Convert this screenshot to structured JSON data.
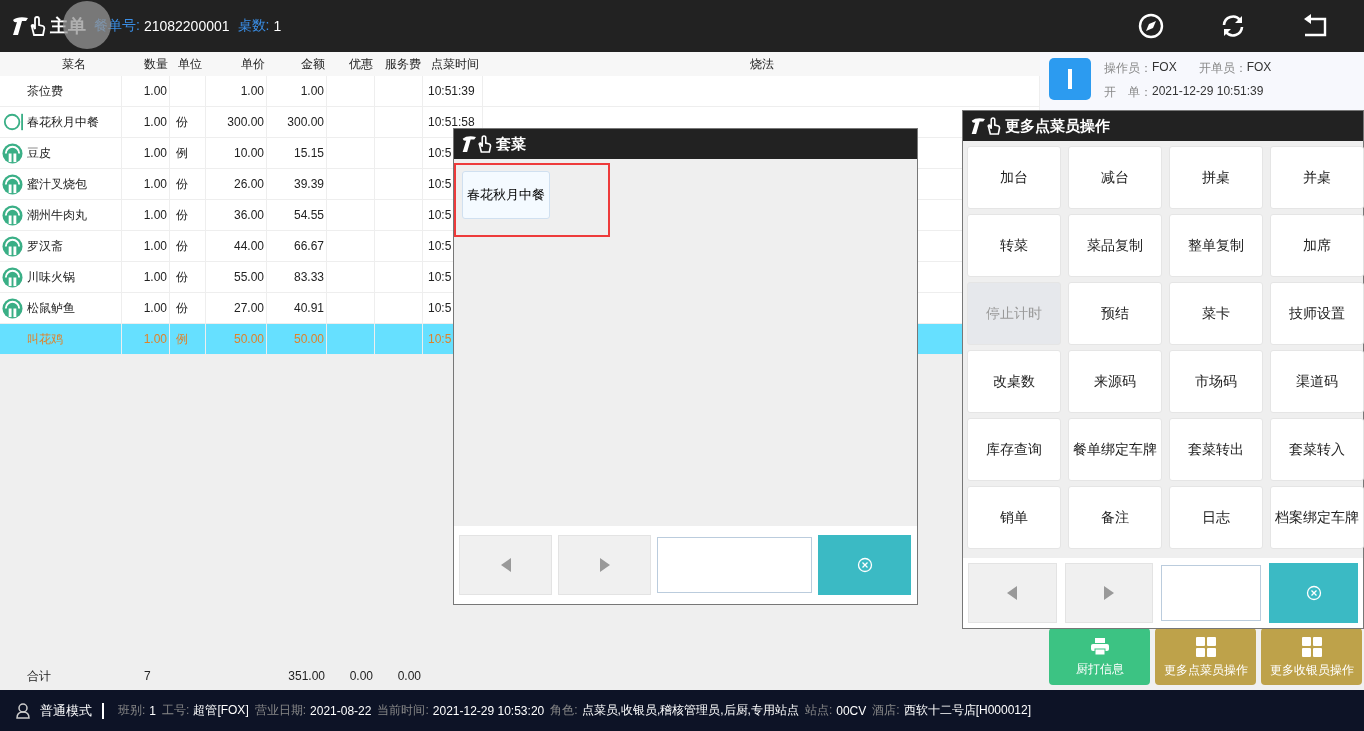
{
  "header": {
    "title": "主单",
    "order_label": "餐单号:",
    "order_no": "21082200001",
    "tables_label": "桌数:",
    "tables": "1"
  },
  "table": {
    "columns": [
      "菜名",
      "数量",
      "单位",
      "单价",
      "金额",
      "优惠",
      "服务费",
      "点菜时间",
      "烧法"
    ],
    "rows": [
      {
        "kind": "none",
        "name": "茶位费",
        "qty": "1.00",
        "unit": "",
        "price": "1.00",
        "amount": "1.00",
        "time": "10:51:39",
        "selected": false
      },
      {
        "kind": "ring",
        "name": "春花秋月中餐",
        "qty": "1.00",
        "unit": "份",
        "price": "300.00",
        "amount": "300.00",
        "time": "10:51:58",
        "selected": false
      },
      {
        "kind": "dish",
        "name": "豆皮",
        "qty": "1.00",
        "unit": "例",
        "price": "10.00",
        "amount": "15.15",
        "time": "10:5",
        "selected": false
      },
      {
        "kind": "dish",
        "name": "蜜汁叉烧包",
        "qty": "1.00",
        "unit": "份",
        "price": "26.00",
        "amount": "39.39",
        "time": "10:5",
        "selected": false
      },
      {
        "kind": "dish",
        "name": "潮州牛肉丸",
        "qty": "1.00",
        "unit": "份",
        "price": "36.00",
        "amount": "54.55",
        "time": "10:5",
        "selected": false
      },
      {
        "kind": "dish",
        "name": "罗汉斋",
        "qty": "1.00",
        "unit": "份",
        "price": "44.00",
        "amount": "66.67",
        "time": "10:5",
        "selected": false
      },
      {
        "kind": "dish",
        "name": "川味火锅",
        "qty": "1.00",
        "unit": "份",
        "price": "55.00",
        "amount": "83.33",
        "time": "10:5",
        "selected": false
      },
      {
        "kind": "dish",
        "name": "松鼠鲈鱼",
        "qty": "1.00",
        "unit": "份",
        "price": "27.00",
        "amount": "40.91",
        "time": "10:5",
        "selected": false
      },
      {
        "kind": "none",
        "name": "叫花鸡",
        "qty": "1.00",
        "unit": "例",
        "price": "50.00",
        "amount": "50.00",
        "time": "10:5",
        "selected": true
      }
    ],
    "totals": {
      "label": "合计",
      "qty": "7",
      "amount": "351.00",
      "discount": "0.00",
      "service": "0.00"
    }
  },
  "info": {
    "operator_label": "操作员：",
    "operator": "FOX",
    "opener_label": "开单员：",
    "opener": "FOX",
    "open_label": "开　单：",
    "open_time": "2021-12-29 10:51:39"
  },
  "action_buttons": [
    {
      "kind": "print",
      "label": "厨打信息"
    },
    {
      "kind": "grid",
      "label": "更多点菜员操作"
    },
    {
      "kind": "grid",
      "label": "更多收银员操作"
    }
  ],
  "set_dialog": {
    "title": "套菜",
    "items": [
      {
        "label": "春花秋月中餐",
        "highlighted": true
      }
    ]
  },
  "ops_dialog": {
    "title": "更多点菜员操作",
    "buttons": [
      {
        "label": "加台",
        "disabled": false
      },
      {
        "label": "减台",
        "disabled": false
      },
      {
        "label": "拼桌",
        "disabled": false
      },
      {
        "label": "并桌",
        "disabled": false
      },
      {
        "label": "转菜",
        "disabled": false
      },
      {
        "label": "菜品复制",
        "disabled": false
      },
      {
        "label": "整单复制",
        "disabled": false
      },
      {
        "label": "加席",
        "disabled": false
      },
      {
        "label": "停止计时",
        "disabled": true
      },
      {
        "label": "预结",
        "disabled": false
      },
      {
        "label": "菜卡",
        "disabled": false
      },
      {
        "label": "技师设置",
        "disabled": false
      },
      {
        "label": "改桌数",
        "disabled": false
      },
      {
        "label": "来源码",
        "disabled": false
      },
      {
        "label": "市场码",
        "disabled": false
      },
      {
        "label": "渠道码",
        "disabled": false
      },
      {
        "label": "库存查询",
        "disabled": false
      },
      {
        "label": "餐单绑定车牌",
        "disabled": false
      },
      {
        "label": "套菜转出",
        "disabled": false
      },
      {
        "label": "套菜转入",
        "disabled": false
      },
      {
        "label": "销单",
        "disabled": false
      },
      {
        "label": "备注",
        "disabled": false
      },
      {
        "label": "日志",
        "disabled": false
      },
      {
        "label": "档案绑定车牌",
        "disabled": false
      }
    ]
  },
  "status_bar": {
    "mode": "普通模式",
    "fields": [
      {
        "label": "班别:",
        "value": "1"
      },
      {
        "label": "工号:",
        "value": "超管[FOX]"
      },
      {
        "label": "营业日期:",
        "value": "2021-08-22"
      },
      {
        "label": "当前时间:",
        "value": "2021-12-29 10:53:20"
      },
      {
        "label": "角色:",
        "value": "点菜员,收银员,稽核管理员,后厨,专用站点"
      },
      {
        "label": "站点:",
        "value": "00CV"
      },
      {
        "label": "酒店:",
        "value": "西软十二号店[H000012]"
      }
    ]
  }
}
